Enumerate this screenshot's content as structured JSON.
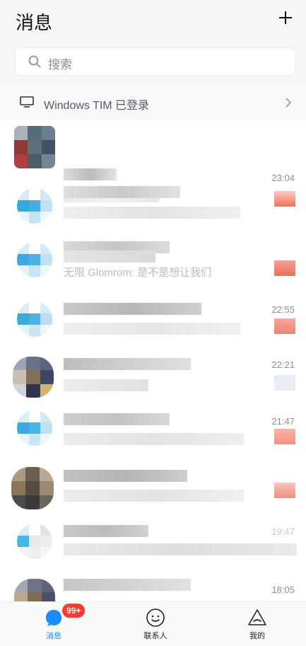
{
  "header": {
    "title": "消息",
    "add_icon": "plus-icon"
  },
  "search": {
    "placeholder": "搜索",
    "icon": "search-icon"
  },
  "device_banner": {
    "text": "Windows TIM 已登录",
    "icon": "desktop-icon",
    "arrow": "chevron-right-icon"
  },
  "conversations": [
    {
      "time": "23:04",
      "snippet": ""
    },
    {
      "time": "",
      "snippet": ""
    },
    {
      "time": "",
      "snippet": "无限 Glomrom: 是不是想让我们"
    },
    {
      "time": "22:55",
      "snippet": ""
    },
    {
      "time": "22:21",
      "snippet": ""
    },
    {
      "time": "21:47",
      "snippet": ""
    },
    {
      "time": "",
      "snippet": ""
    },
    {
      "time": "19:47",
      "snippet": ""
    },
    {
      "time": "18:05",
      "snippet": ""
    }
  ],
  "tabbar": {
    "messages_label": "消息",
    "messages_badge": "99+",
    "contacts_label": "联系人",
    "me_label": "我的"
  },
  "colors": {
    "accent": "#1a8cff",
    "badge": "#ff3b30"
  }
}
